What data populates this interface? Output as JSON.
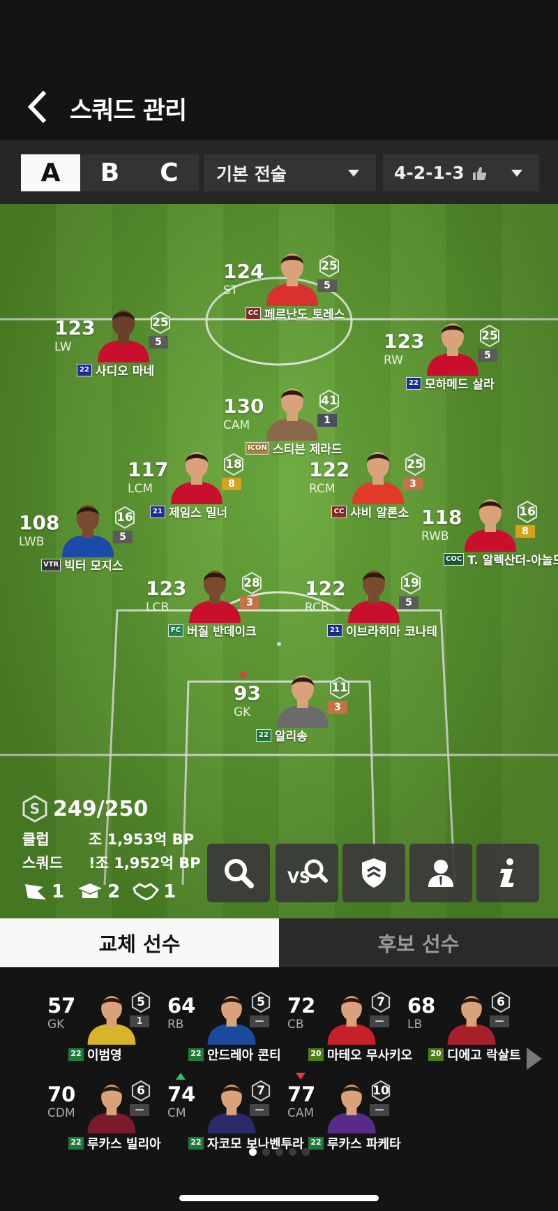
{
  "header": {
    "title": "스쿼드 관리",
    "back_icon": "chevron-left-icon"
  },
  "squad_tabs": [
    {
      "label": "A",
      "active": true
    },
    {
      "label": "B",
      "active": false
    },
    {
      "label": "C",
      "active": false
    }
  ],
  "tactic_dropdown": {
    "value": "기본 전술"
  },
  "formation_dropdown": {
    "value": "4-2-1-3",
    "icon": "thumbs-up-icon"
  },
  "players": [
    {
      "rating": "124",
      "pos": "ST",
      "name": "페르난도 토레스",
      "badge": "CC",
      "badge_color": "#8a2a2a",
      "level": "25",
      "grade": "5",
      "grade_color": "#5a5a5a",
      "kit": "#d93030"
    },
    {
      "rating": "123",
      "pos": "LW",
      "name": "사디오 마네",
      "badge": "22",
      "badge_color": "#1d2e9b",
      "level": "25",
      "grade": "5",
      "grade_color": "#5a5a5a",
      "kit": "#c8102e"
    },
    {
      "rating": "123",
      "pos": "RW",
      "name": "모하메드 살라",
      "badge": "22",
      "badge_color": "#1d2e9b",
      "level": "25",
      "grade": "5",
      "grade_color": "#5a5a5a",
      "kit": "#c8102e"
    },
    {
      "rating": "130",
      "pos": "CAM",
      "name": "스티븐 제라드",
      "badge": "ICON",
      "badge_color": "#a88a3c",
      "level": "41",
      "grade": "1",
      "grade_color": "#4a4f60",
      "kit": "#8a6a4a"
    },
    {
      "rating": "117",
      "pos": "LCM",
      "name": "제임스 밀너",
      "badge": "21",
      "badge_color": "#1d2e9b",
      "level": "18",
      "grade": "8",
      "grade_color": "#d6a21c",
      "kit": "#c8102e"
    },
    {
      "rating": "122",
      "pos": "RCM",
      "name": "샤비 알론소",
      "badge": "CC",
      "badge_color": "#8a2a2a",
      "level": "25",
      "grade": "3",
      "grade_color": "#c8704a",
      "kit": "#e03a2a"
    },
    {
      "rating": "108",
      "pos": "LWB",
      "name": "빅터 모지스",
      "badge": "VTR",
      "badge_color": "#3a3a3a",
      "level": "16",
      "grade": "5",
      "grade_color": "#5a5a5a",
      "kit": "#1b4aa8"
    },
    {
      "rating": "118",
      "pos": "RWB",
      "name": "T. 알렉산더-아놀드",
      "badge": "COC",
      "badge_color": "#1e5a3c",
      "level": "16",
      "grade": "8",
      "grade_color": "#d6a21c",
      "kit": "#c8102e"
    },
    {
      "rating": "123",
      "pos": "LCB",
      "name": "버질 반데이크",
      "badge": "FC",
      "badge_color": "#1e8a4a",
      "level": "28",
      "grade": "3",
      "grade_color": "#c8704a",
      "kit": "#c8102e"
    },
    {
      "rating": "122",
      "pos": "RCB",
      "name": "이브라히마 코나테",
      "badge": "21",
      "badge_color": "#1d2e9b",
      "level": "19",
      "grade": "5",
      "grade_color": "#5a5a5a",
      "kit": "#c8102e"
    },
    {
      "rating": "93",
      "pos": "GK",
      "name": "알리송",
      "badge": "22",
      "badge_color": "#1f7a3a",
      "level": "11",
      "grade": "3",
      "grade_color": "#c8704a",
      "kit": "#6b6b6b"
    }
  ],
  "salary": {
    "value": "249/250",
    "icon": "salary-s-icon"
  },
  "values": [
    {
      "label": "클럽",
      "amount": "조 1,953억 BP"
    },
    {
      "label": "스쿼드",
      "amount": "!조 1,952억 BP"
    }
  ],
  "counts": [
    {
      "icon": "captain-flag-icon",
      "value": "1"
    },
    {
      "icon": "graduation-cap-icon",
      "value": "2"
    },
    {
      "icon": "handshake-icon",
      "value": "1"
    }
  ],
  "tools": [
    "search-icon",
    "vs-compare-icon",
    "shield-icon",
    "manager-icon",
    "info-icon"
  ],
  "bottom_tabs": [
    {
      "label": "교체 선수",
      "active": true
    },
    {
      "label": "후보 선수",
      "active": false
    }
  ],
  "subs": [
    {
      "rating": "57",
      "pos": "GK",
      "name": "이범영",
      "badge": "22",
      "level": "5",
      "grade": "1",
      "kit": "#d8b42a",
      "trend": ""
    },
    {
      "rating": "64",
      "pos": "RB",
      "name": "안드레아 콘티",
      "badge": "22",
      "level": "5",
      "grade": "—",
      "kit": "#1a4aa0",
      "trend": ""
    },
    {
      "rating": "72",
      "pos": "CB",
      "name": "마테오 무사키오",
      "badge": "20",
      "level": "7",
      "grade": "—",
      "kit": "#c8202a",
      "trend": ""
    },
    {
      "rating": "68",
      "pos": "LB",
      "name": "디에고 락살트",
      "badge": "20",
      "level": "6",
      "grade": "—",
      "kit": "#a8202a",
      "trend": ""
    },
    {
      "rating": "70",
      "pos": "CDM",
      "name": "루카스 빌리아",
      "badge": "22",
      "level": "6",
      "grade": "—",
      "kit": "#7a1a2a",
      "trend": ""
    },
    {
      "rating": "74",
      "pos": "CM",
      "name": "자코모 보나벤투라",
      "badge": "22",
      "level": "7",
      "grade": "—",
      "kit": "#2a2a6a",
      "trend": "up"
    },
    {
      "rating": "77",
      "pos": "CAM",
      "name": "루카스 파케타",
      "badge": "22",
      "level": "10",
      "grade": "—",
      "kit": "#5a2a8a",
      "trend": "down"
    }
  ],
  "page_dots": {
    "count": 5,
    "active": 1
  }
}
